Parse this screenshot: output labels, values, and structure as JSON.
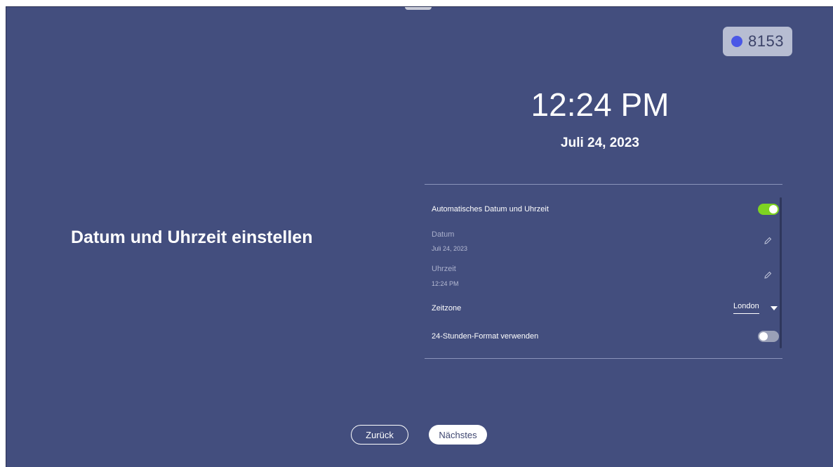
{
  "device": {
    "id_number": "8153",
    "id_dot_color": "#4a57e6"
  },
  "page": {
    "title": "Datum und Uhrzeit einstellen"
  },
  "clock": {
    "time": "12:24 PM",
    "date": "Juli 24, 2023"
  },
  "settings": {
    "auto_datetime": {
      "label": "Automatisches Datum und Uhrzeit",
      "enabled": true
    },
    "date": {
      "label": "Datum",
      "value": "Juli 24, 2023"
    },
    "time": {
      "label": "Uhrzeit",
      "value": "12:24 PM"
    },
    "timezone": {
      "label": "Zeitzone",
      "value": "London"
    },
    "format_24h": {
      "label": "24-Stunden-Format verwenden",
      "enabled": false
    }
  },
  "buttons": {
    "back": "Zurück",
    "next": "Nächstes"
  },
  "colors": {
    "background": "#434e7e",
    "toggle_on": "#7ed321",
    "toggle_off": "#9aa0b7"
  }
}
